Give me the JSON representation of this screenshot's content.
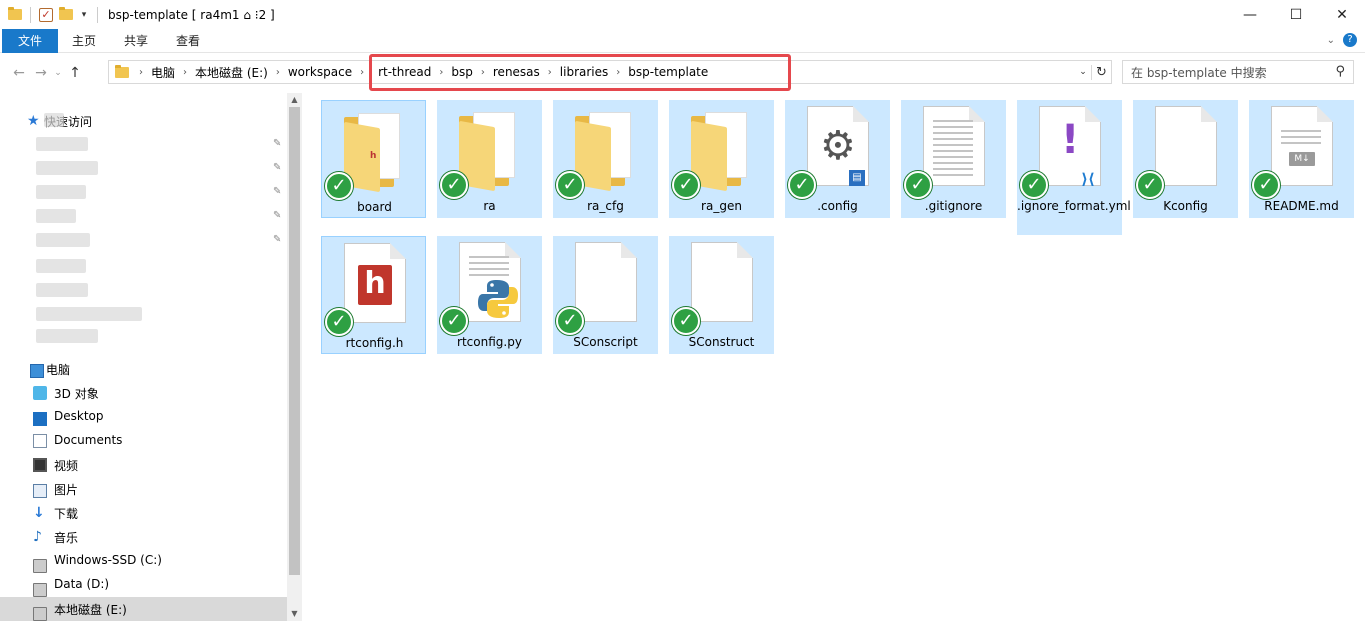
{
  "window": {
    "title": "bsp-template [ ra4m1 ⌂ ⁝2 ]",
    "buttons": {
      "minimize": "—",
      "maximize": "☐",
      "close": "✕"
    }
  },
  "ribbon": {
    "tabs": [
      "文件",
      "主页",
      "共享",
      "查看"
    ],
    "expand_icon": "chevron-down-icon",
    "help": "?"
  },
  "nav": {
    "back": "←",
    "forward": "→",
    "recent": "⌄",
    "up": "↑"
  },
  "address": {
    "crumbs": [
      "电脑",
      "本地磁盘 (E:)",
      "workspace",
      "rt-thread",
      "bsp",
      "renesas",
      "libraries",
      "bsp-template"
    ],
    "separator": "›",
    "dropdown": "⌄",
    "refresh": "↻"
  },
  "search": {
    "placeholder": "在 bsp-template 中搜索",
    "icon": "⚲"
  },
  "sidebar": {
    "quick_access_label": "快速访问",
    "this_pc": "电脑",
    "items": [
      {
        "label": "3D 对象",
        "icon": "3d-objects-icon"
      },
      {
        "label": "Desktop",
        "icon": "desktop-icon"
      },
      {
        "label": "Documents",
        "icon": "documents-icon"
      },
      {
        "label": "视频",
        "icon": "videos-icon"
      },
      {
        "label": "图片",
        "icon": "pictures-icon"
      },
      {
        "label": "下载",
        "icon": "downloads-icon"
      },
      {
        "label": "音乐",
        "icon": "music-icon"
      },
      {
        "label": "Windows-SSD (C:)",
        "icon": "drive-icon"
      },
      {
        "label": "Data (D:)",
        "icon": "drive-icon"
      },
      {
        "label": "本地磁盘 (E:)",
        "icon": "drive-icon",
        "selected": true
      }
    ],
    "pin_glyph": "📌"
  },
  "files": [
    {
      "name": "board",
      "type": "folder"
    },
    {
      "name": "ra",
      "type": "folder"
    },
    {
      "name": "ra_cfg",
      "type": "folder"
    },
    {
      "name": "ra_gen",
      "type": "folder"
    },
    {
      "name": ".config",
      "type": "config"
    },
    {
      "name": ".gitignore",
      "type": "text"
    },
    {
      "name": ".ignore_format.yml",
      "type": "yml"
    },
    {
      "name": "Kconfig",
      "type": "blank"
    },
    {
      "name": "README.md",
      "type": "markdown"
    },
    {
      "name": "rtconfig.h",
      "type": "header"
    },
    {
      "name": "rtconfig.py",
      "type": "python"
    },
    {
      "name": "SConscript",
      "type": "blank"
    },
    {
      "name": "SConstruct",
      "type": "blank"
    }
  ],
  "badge_glyph": "✓",
  "glyphs": {
    "gear": "⚙",
    "exclaim": "!",
    "md": "M↓",
    "h": "h",
    "vs": "⟩⟨",
    "book": "▤"
  },
  "colors": {
    "accent": "#1979ca",
    "selection": "#cce8ff",
    "highlight": "#e5484d",
    "sync_ok": "#2ea043"
  }
}
